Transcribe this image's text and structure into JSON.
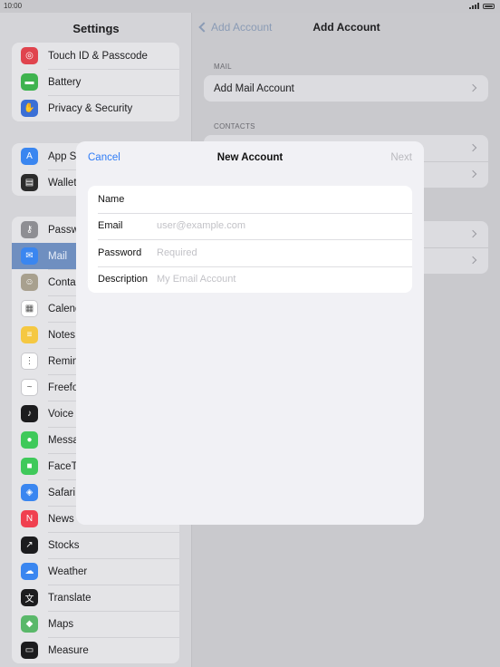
{
  "status": {
    "time": "10:00"
  },
  "sidebar": {
    "title": "Settings",
    "groups": [
      {
        "items": [
          {
            "label": "Touch ID & Passcode",
            "icon": "fingerprint-icon",
            "color": "#e0444e"
          },
          {
            "label": "Battery",
            "icon": "battery-icon",
            "color": "#3fb34f"
          },
          {
            "label": "Privacy & Security",
            "icon": "hand-icon",
            "color": "#3a6fd6"
          }
        ]
      },
      {
        "items": [
          {
            "label": "App S",
            "icon": "app-store-icon",
            "color": "#3a86f0"
          },
          {
            "label": "Wallet",
            "icon": "wallet-icon",
            "color": "#2b2b2b"
          }
        ]
      },
      {
        "items": [
          {
            "label": "Passw",
            "icon": "key-icon",
            "color": "#8e8e93"
          },
          {
            "label": "Mail",
            "icon": "mail-icon",
            "color": "#3a86f0",
            "selected": true
          },
          {
            "label": "Conta",
            "icon": "contacts-icon",
            "color": "#a8a08e"
          },
          {
            "label": "Calend",
            "icon": "calendar-icon",
            "color": "#ffffff"
          },
          {
            "label": "Notes",
            "icon": "notes-icon",
            "color": "#f5c842"
          },
          {
            "label": "Remin",
            "icon": "reminders-icon",
            "color": "#ffffff"
          },
          {
            "label": "Freefo",
            "icon": "freeform-icon",
            "color": "#ffffff"
          },
          {
            "label": "Voice",
            "icon": "voice-memos-icon",
            "color": "#1c1c1e"
          },
          {
            "label": "Messa",
            "icon": "messages-icon",
            "color": "#3fc95a"
          },
          {
            "label": "FaceTi",
            "icon": "facetime-icon",
            "color": "#3fc95a"
          },
          {
            "label": "Safari",
            "icon": "safari-icon",
            "color": "#3a86f0"
          },
          {
            "label": "News",
            "icon": "news-icon",
            "color": "#f04050"
          },
          {
            "label": "Stocks",
            "icon": "stocks-icon",
            "color": "#1c1c1e"
          },
          {
            "label": "Weather",
            "icon": "weather-icon",
            "color": "#3a86f0"
          },
          {
            "label": "Translate",
            "icon": "translate-icon",
            "color": "#1c1c1e"
          },
          {
            "label": "Maps",
            "icon": "maps-icon",
            "color": "#5ab86a"
          },
          {
            "label": "Measure",
            "icon": "measure-icon",
            "color": "#1c1c1e"
          }
        ]
      }
    ]
  },
  "detail": {
    "back_label": "Add Account",
    "title": "Add Account",
    "mail_section": "MAIL",
    "add_mail_label": "Add Mail Account",
    "contacts_section": "CONTACTS"
  },
  "modal": {
    "cancel_label": "Cancel",
    "title": "New Account",
    "next_label": "Next",
    "fields": [
      {
        "label": "Name",
        "value": "",
        "placeholder": ""
      },
      {
        "label": "Email",
        "value": "",
        "placeholder": "user@example.com"
      },
      {
        "label": "Password",
        "value": "",
        "placeholder": "Required"
      },
      {
        "label": "Description",
        "value": "",
        "placeholder": "My Email Account"
      }
    ]
  },
  "colors": {
    "accent": "#2f7cf6",
    "selected_row": "#6f8fc0"
  }
}
